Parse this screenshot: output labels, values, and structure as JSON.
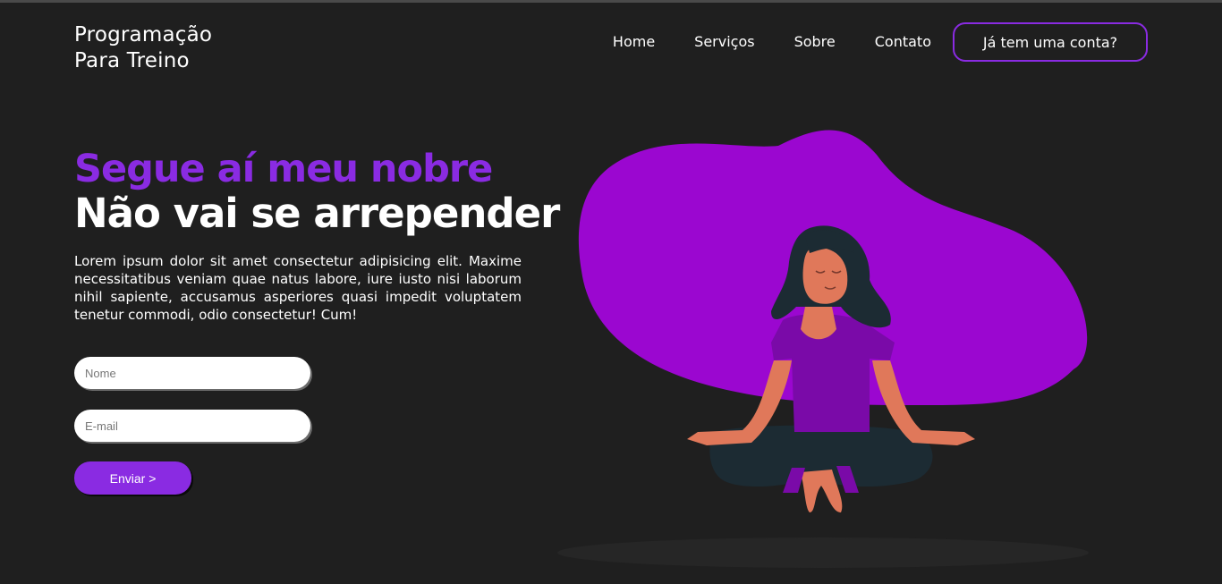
{
  "logo": {
    "line1": "Programação",
    "line2": "Para Treino"
  },
  "nav": {
    "items": [
      "Home",
      "Serviços",
      "Sobre",
      "Contato"
    ],
    "account_button": "Já tem uma conta?"
  },
  "hero": {
    "title_line1": "Segue aí meu nobre",
    "title_line2": "Não vai se arrepender",
    "text": "Lorem ipsum dolor sit amet consectetur adipisicing elit. Maxime necessitatibus veniam quae natus labore, iure iusto nisi laborum nihil sapiente, accusamus asperiores quasi impedit voluptatem tenetur commodi, odio consectetur! Cum!"
  },
  "form": {
    "name_placeholder": "Nome",
    "email_placeholder": "E-mail",
    "submit_label": "Enviar >"
  },
  "colors": {
    "accent": "#8a2be2",
    "background": "#1f1f1f",
    "blob": "#9b07d0"
  },
  "illustration": {
    "icon": "meditating-woman-illustration"
  }
}
